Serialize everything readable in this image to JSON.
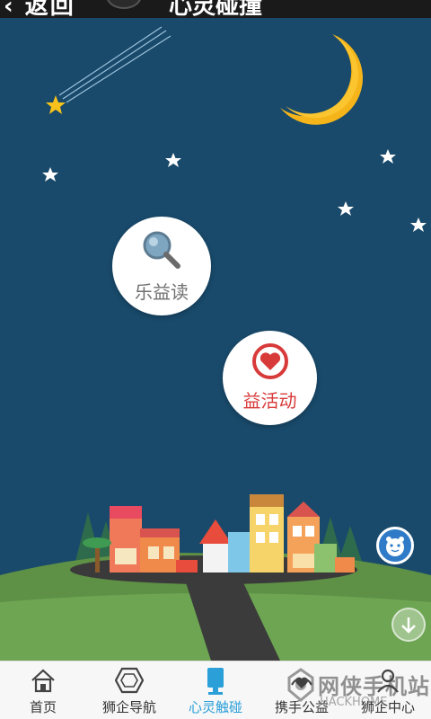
{
  "header": {
    "back_label": "‹ 返回",
    "title": "心灵碰撞"
  },
  "bubbles": {
    "read": {
      "label": "乐益读",
      "icon": "magnifier-icon"
    },
    "activity": {
      "label": "益活动",
      "icon": "heart-icon"
    }
  },
  "tabs": [
    {
      "label": "首页",
      "icon": "home-icon",
      "active": false
    },
    {
      "label": "狮企导航",
      "icon": "hexagon-icon",
      "active": false
    },
    {
      "label": "心灵触碰",
      "icon": "cup-icon",
      "active": true
    },
    {
      "label": "携手公益",
      "icon": "hands-icon",
      "active": false
    },
    {
      "label": "狮企中心",
      "icon": "user-icon",
      "active": false
    }
  ],
  "watermark": {
    "text": "网侠手机站",
    "sub": "HACKHOME"
  },
  "colors": {
    "sky": "#194a6b",
    "active": "#2a9fd8",
    "grass": "#5e9046",
    "heart": "#d83a3a"
  }
}
